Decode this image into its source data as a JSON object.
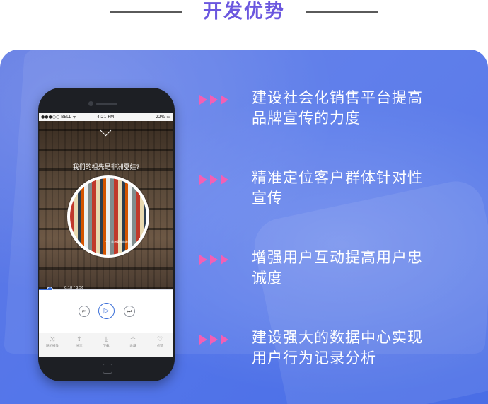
{
  "header": {
    "title": "开发优势"
  },
  "phone": {
    "status": {
      "carrier": "●●●○○ BELL ᯤ",
      "time": "4:21 PM",
      "battery": "22% ▭"
    },
    "player": {
      "song_title": "我们的祖先是非洲夏娃?",
      "timecode": "0:18 / 3:56",
      "disc_caption": "—— 非洲夏娃的故事",
      "progress": 0.08
    },
    "controls": {
      "prev_icon": "⏮",
      "play_icon": "▷",
      "next_icon": "⏭"
    },
    "tabs": [
      {
        "icon": "⤨",
        "label": "随机播放"
      },
      {
        "icon": "⇪",
        "label": "分享"
      },
      {
        "icon": "⤓",
        "label": "下载"
      },
      {
        "icon": "☆",
        "label": "收藏"
      },
      {
        "icon": "♡",
        "label": "点赞"
      }
    ]
  },
  "features": [
    {
      "text": "建设社会化销售平台提高\n品牌宣传的力度"
    },
    {
      "text": "精准定位客户群体针对性\n宣传"
    },
    {
      "text": "增强用户互动提高用户忠\n诚度"
    },
    {
      "text": "建设强大的数据中心实现\n用户行为记录分析"
    }
  ],
  "colors": {
    "title": "#6b57df",
    "accent_arrows": "#f35fb4",
    "panel": "#5476ea"
  }
}
